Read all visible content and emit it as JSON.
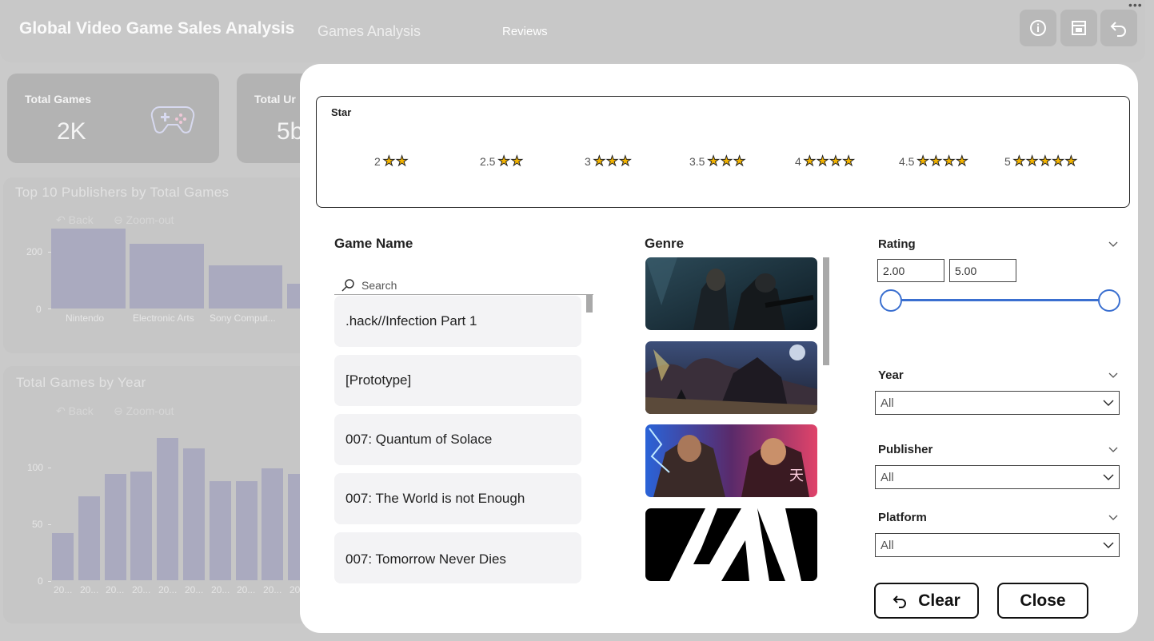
{
  "header": {
    "title": "Global Video Game Sales Analysis",
    "nav": {
      "games": "Games Analysis",
      "reviews": "Reviews"
    },
    "more": "•••",
    "buttons": [
      {
        "icon": "info-icon"
      },
      {
        "icon": "filter-panel-icon"
      },
      {
        "icon": "back-icon"
      }
    ]
  },
  "kpis": [
    {
      "label": "Total Games",
      "value": "2K",
      "icon": "gamepad-icon"
    },
    {
      "label": "Total Ur",
      "value": "5b"
    }
  ],
  "publishers_panel": {
    "title": "Top 10 Publishers by Total Games",
    "back_label": "Back",
    "zoom_label": "Zoom-out",
    "y_ticks": [
      "200",
      "0"
    ],
    "categories": [
      "Nintendo",
      "Electronic Arts",
      "Sony Comput..."
    ]
  },
  "year_panel": {
    "title": "Total Games by Year",
    "back_label": "Back",
    "zoom_label": "Zoom-out",
    "y_ticks": [
      "100",
      "50",
      "0"
    ],
    "categories": [
      "20...",
      "20...",
      "20...",
      "20...",
      "20...",
      "20...",
      "20...",
      "20...",
      "20...",
      "20..."
    ]
  },
  "chart_data": [
    {
      "type": "bar",
      "title": "Top 10 Publishers by Total Games",
      "categories": [
        "Nintendo",
        "Electronic Arts",
        "Sony Comput...",
        "(partially hidden)"
      ],
      "values": [
        280,
        230,
        150,
        60
      ],
      "ylim": [
        0,
        280
      ]
    },
    {
      "type": "bar",
      "title": "Total Games by Year",
      "categories": [
        "20...",
        "20...",
        "20...",
        "20...",
        "20...",
        "20...",
        "20...",
        "20...",
        "20...",
        "20..."
      ],
      "values": [
        42,
        74,
        94,
        96,
        126,
        117,
        88,
        88,
        99,
        94
      ],
      "ylim": [
        0,
        130
      ]
    }
  ],
  "modal": {
    "star": {
      "title": "Star",
      "options": [
        {
          "value": "2",
          "rating": 2
        },
        {
          "value": "2.5",
          "rating": 2
        },
        {
          "value": "3",
          "rating": 3
        },
        {
          "value": "3.5",
          "rating": 3
        },
        {
          "value": "4",
          "rating": 4
        },
        {
          "value": "4.5",
          "rating": 4
        },
        {
          "value": "5",
          "rating": 5
        }
      ]
    },
    "game_name": {
      "title": "Game Name",
      "search_placeholder": "Search",
      "items": [
        ".hack//Infection Part 1",
        "[Prototype]",
        "007: Quantum of Solace",
        "007: The World is not Enough",
        "007: Tomorrow Never Dies"
      ]
    },
    "genre": {
      "title": "Genre",
      "tiles": [
        "dark-shooter-art",
        "dark-fantasy-art",
        "fighting-game-art",
        "white-logo-art"
      ]
    },
    "rating": {
      "label": "Rating",
      "min": "2.00",
      "max": "5.00",
      "range_low": 0.0,
      "range_high": 1.0
    },
    "year": {
      "label": "Year",
      "value": "All"
    },
    "publisher": {
      "label": "Publisher",
      "value": "All"
    },
    "platform": {
      "label": "Platform",
      "value": "All"
    },
    "clear_label": "Clear",
    "close_label": "Close"
  }
}
